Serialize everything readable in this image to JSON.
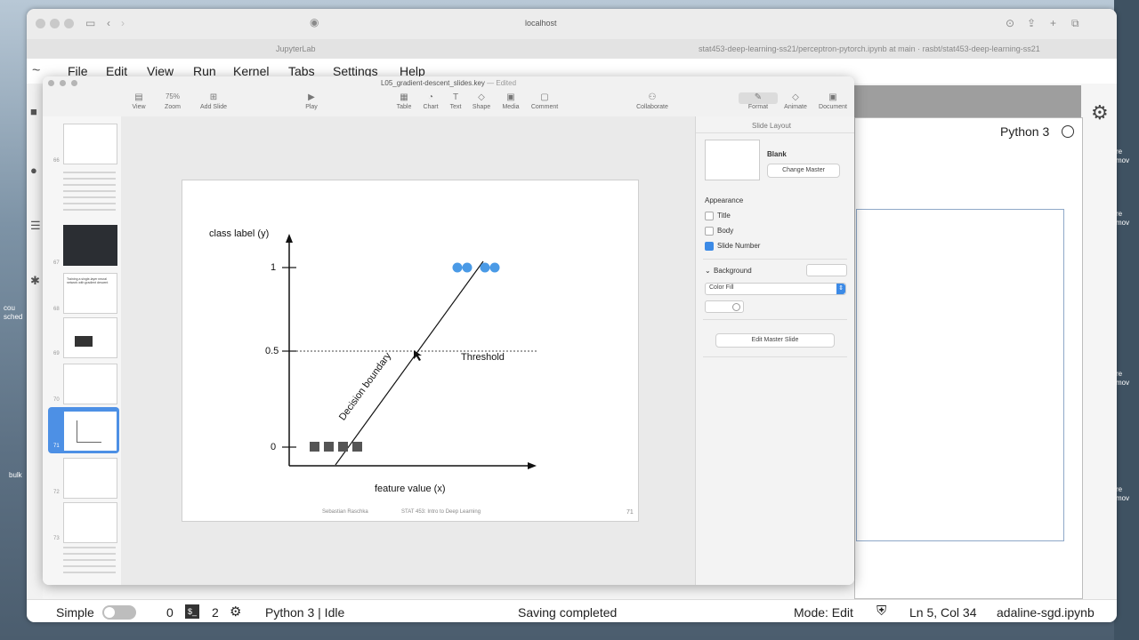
{
  "safari": {
    "address": "localhost",
    "tab_left": "JupyterLab",
    "tab_right": "stat453-deep-learning-ss21/perceptron-pytorch.ipynb at main · rasbt/stat453-deep-learning-ss21"
  },
  "jupyter": {
    "menu": [
      "File",
      "Edit",
      "View",
      "Run",
      "Kernel",
      "Tabs",
      "Settings",
      "Help"
    ],
    "kernel_name": "Python 3",
    "status": {
      "mode_label": "Simple",
      "terminals": "0",
      "kernels": "2",
      "kernel_status": "Python 3 | Idle",
      "save_status": "Saving completed",
      "edit_mode": "Mode: Edit",
      "cursor": "Ln 5, Col 34",
      "file": "adaline-sgd.ipynb"
    }
  },
  "keynote": {
    "title": "L05_gradient-descent_slides.key",
    "edited": "— Edited",
    "toolbar": {
      "view": "View",
      "zoom_value": "75%",
      "zoom": "Zoom",
      "add_slide": "Add Slide",
      "play": "Play",
      "table": "Table",
      "chart": "Chart",
      "text": "Text",
      "shape": "Shape",
      "media": "Media",
      "comment": "Comment",
      "collaborate": "Collaborate",
      "format": "Format",
      "animate": "Animate",
      "document": "Document"
    },
    "thumbnails": [
      {
        "num": "66"
      },
      {
        "num": "67"
      },
      {
        "num": "68"
      },
      {
        "num": "69"
      },
      {
        "num": "70"
      },
      {
        "num": "71"
      },
      {
        "num": "72"
      },
      {
        "num": "73"
      }
    ],
    "thumb_text": {
      "t68": "Training a single-layer neural network with gradient descent"
    },
    "inspector": {
      "header": "Slide Layout",
      "layout_name": "Blank",
      "change_master": "Change Master",
      "appearance": "Appearance",
      "title": "Title",
      "body": "Body",
      "slide_number": "Slide Number",
      "background": "Background",
      "fill": "Color Fill",
      "edit_master": "Edit Master Slide"
    },
    "slide": {
      "ylabel": "class label (y)",
      "xlabel": "feature value (x)",
      "ticks": [
        "1",
        "0.5",
        "0"
      ],
      "threshold": "Threshold",
      "decision": "Decision boundary",
      "footer_author": "Sebastian Raschka",
      "footer_course": "STAT 453: Intro to Deep Learning",
      "page": "71"
    }
  },
  "desktop": {
    "side_text": [
      "cou",
      "sched",
      "bulk",
      "re",
      "mov"
    ]
  }
}
